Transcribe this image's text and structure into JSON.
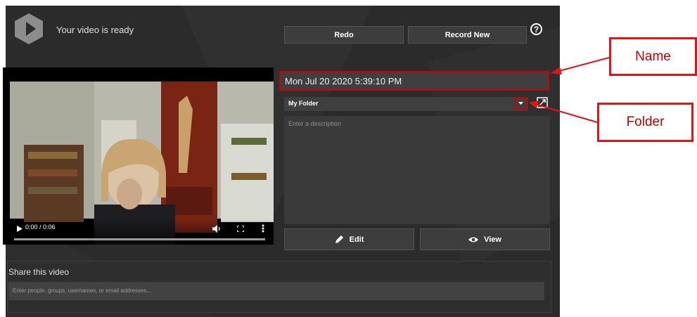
{
  "header": {
    "status": "Your video is ready",
    "redo_label": "Redo",
    "record_new_label": "Record New",
    "help_glyph": "?"
  },
  "player": {
    "time": "0:00 / 0:06",
    "progress": 0.0
  },
  "form": {
    "name_value": "Mon Jul 20 2020 5:39:10 PM",
    "folder_value": "My Folder",
    "description_placeholder": "Enter a description",
    "edit_label": "Edit",
    "view_label": "View"
  },
  "share": {
    "title": "Share this video",
    "placeholder": "Enter people, groups, usernames, or email addresses..."
  },
  "callouts": {
    "name": "Name",
    "folder": "Folder"
  },
  "colors": {
    "panel": "#2b2b2b",
    "field": "#3f3f3f",
    "highlight": "#d00000",
    "callout_text": "#c00000"
  }
}
